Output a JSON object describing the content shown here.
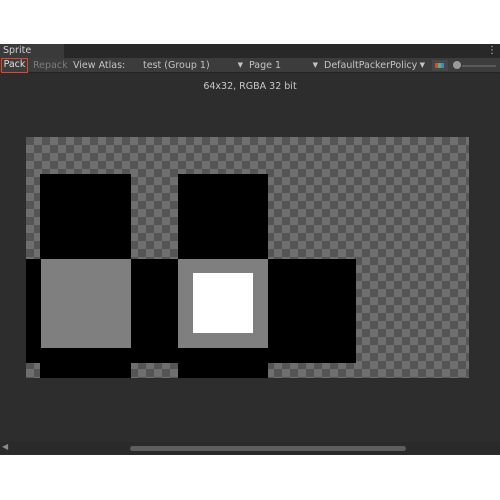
{
  "window": {
    "tab_title": "Sprite Packer",
    "menu_icon": "kebab-menu-icon"
  },
  "toolbar": {
    "pack_label": "Pack",
    "repack_label": "Repack",
    "view_atlas_label": "View Atlas:",
    "atlas_value": "test (Group 1)",
    "page_value": "Page 1",
    "policy_value": "DefaultPackerPolicy",
    "color_channel_icon": "rgb-channels-icon",
    "zoom_slider_icon": "zoom-slider"
  },
  "texture_info": "64x32, RGBA 32 bit",
  "colors": {
    "window_bg": "#2d2d2d",
    "toolbar_bg": "#3c3c3c",
    "highlight": "#e0452c",
    "checker_dark": "#555555",
    "checker_light": "#6f6f6f"
  }
}
